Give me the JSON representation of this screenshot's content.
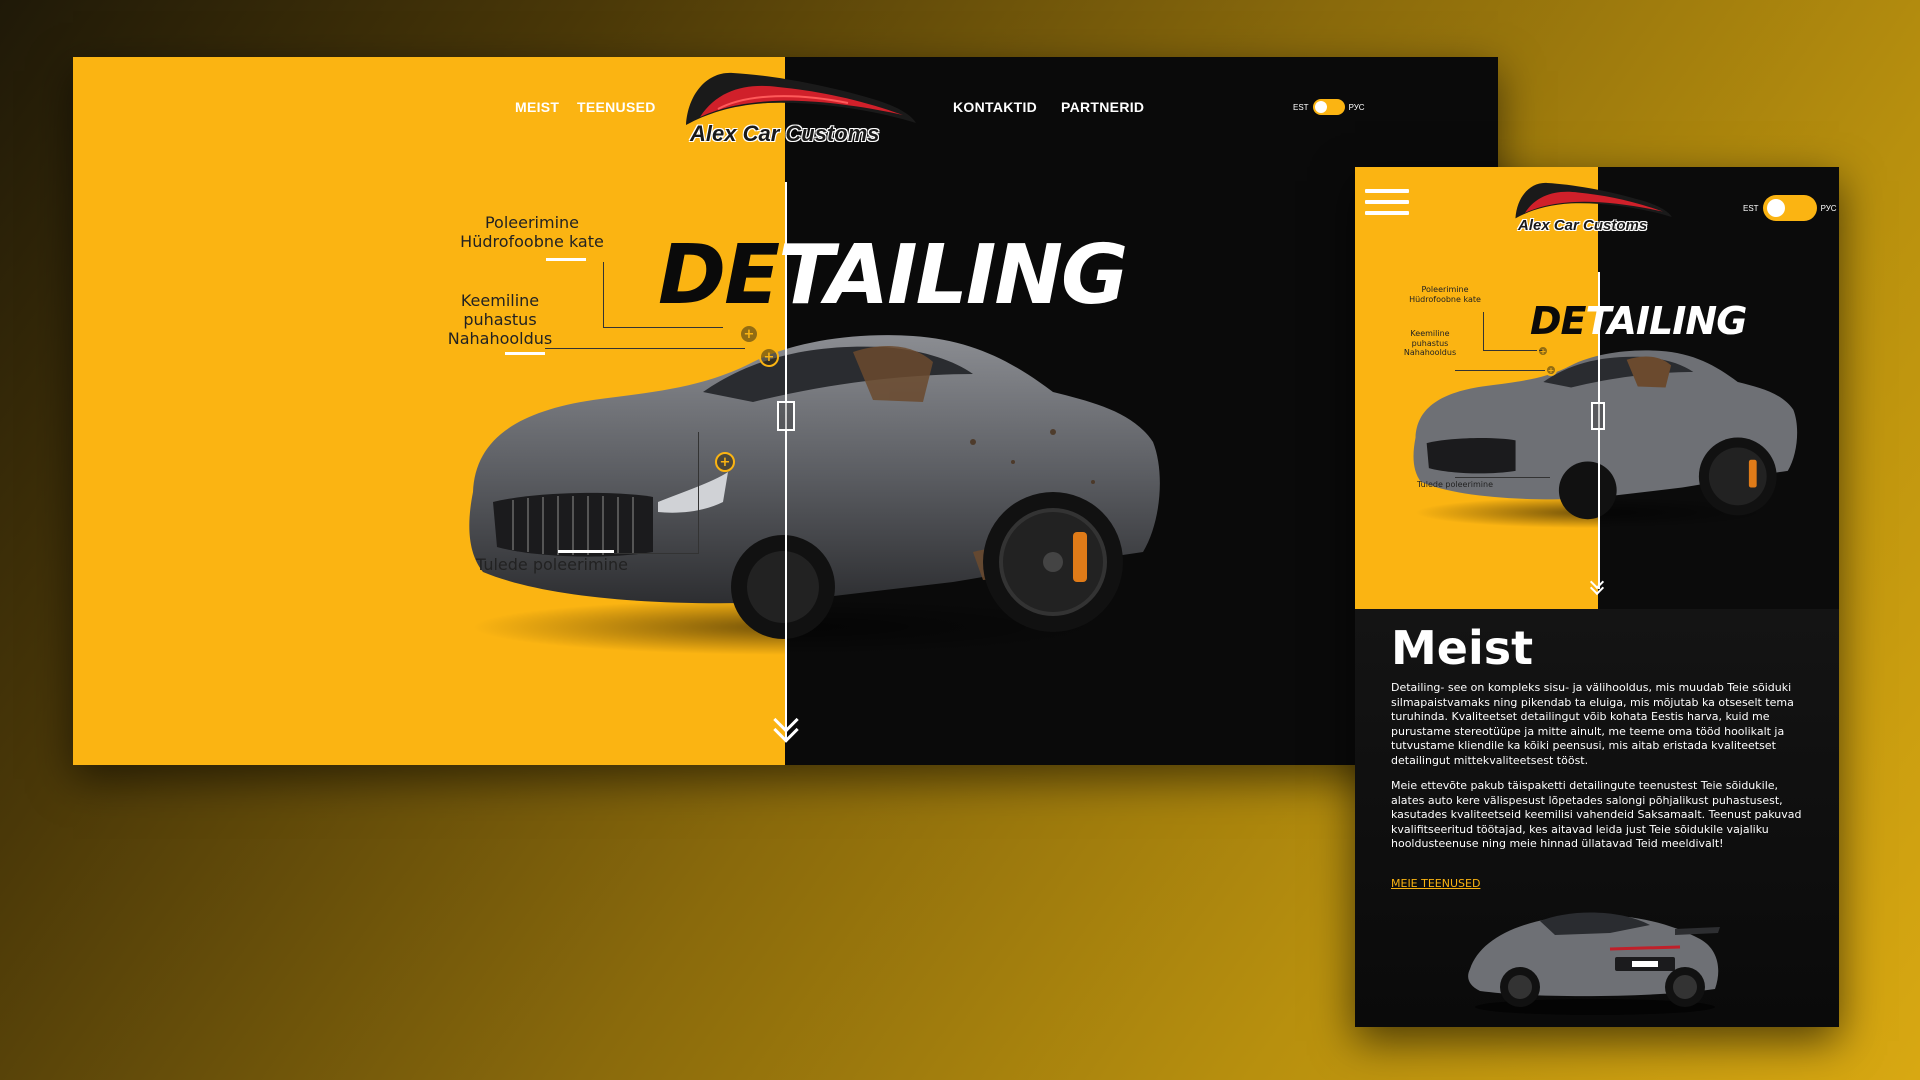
{
  "colors": {
    "accent": "#fbb412",
    "dark": "#0a0a0a",
    "text_light": "#ffffff",
    "logo_red": "#d0202a"
  },
  "desktop": {
    "nav": {
      "meist": "MEIST",
      "teenused": "TEENUSED",
      "kontaktid": "KONTAKTID",
      "partnerid": "PARTNERID"
    },
    "logo_text": "Alex Car Customs",
    "lang": {
      "left": "EST",
      "right": "РУС"
    },
    "hero": {
      "title_dark": "DE",
      "title_light": "TAILING",
      "callouts": {
        "polish_line1": "Poleerimine",
        "polish_line2": "Hüdrofoobne kate",
        "clean_line1": "Keemiline",
        "clean_line2": "puhastus",
        "clean_line3": "Nahahooldus",
        "lights": "Tulede poleerimine"
      }
    },
    "icons": {
      "hotspot": "plus-circle-icon",
      "scroll": "double-chevron-down-icon"
    }
  },
  "mobile": {
    "logo_text": "Alex Car Customs",
    "lang": {
      "left": "EST",
      "right": "РУС"
    },
    "hero": {
      "title_dark": "DE",
      "title_light": "TAILING",
      "callouts": {
        "polish_line1": "Poleerimine",
        "polish_line2": "Hüdrofoobne kate",
        "clean_line1": "Keemiline",
        "clean_line2": "puhastus",
        "clean_line3": "Nahahooldus",
        "lights": "Tulede poleerimine"
      }
    },
    "about": {
      "title": "Meist",
      "paragraph1": "Detailing- see on kompleks sisu- ja välihooldus, mis muudab Teie sõiduki silmapaistvamaks ning pikendab ta eluiga, mis mõjutab ka otseselt tema turuhinda. Kvaliteetset detailingut võib kohata Eestis harva, kuid me purustame stereotüüpe ja mitte ainult, me teeme oma tööd hoolikalt ja tutvustame kliendile ka kõiki peensusi, mis aitab eristada kvaliteetset detailingut mittekvaliteetsest tööst.",
      "paragraph2": "Meie ettevõte pakub täispaketti detailingute teenustest Teie sõidukile, alates auto kere välispesust lõpetades salongi põhjalikust puhastusest, kasutades kvaliteetseid keemilisi vahendeid Saksamaalt. Teenust pakuvad kvalifitseeritud töötajad, kes aitavad leida just Teie sõidukile vajaliku hooldusteenuse ning meie hinnad üllatavad Teid meeldivalt!",
      "link": "MEIE TEENUSED"
    },
    "icons": {
      "menu": "hamburger-menu-icon"
    }
  }
}
